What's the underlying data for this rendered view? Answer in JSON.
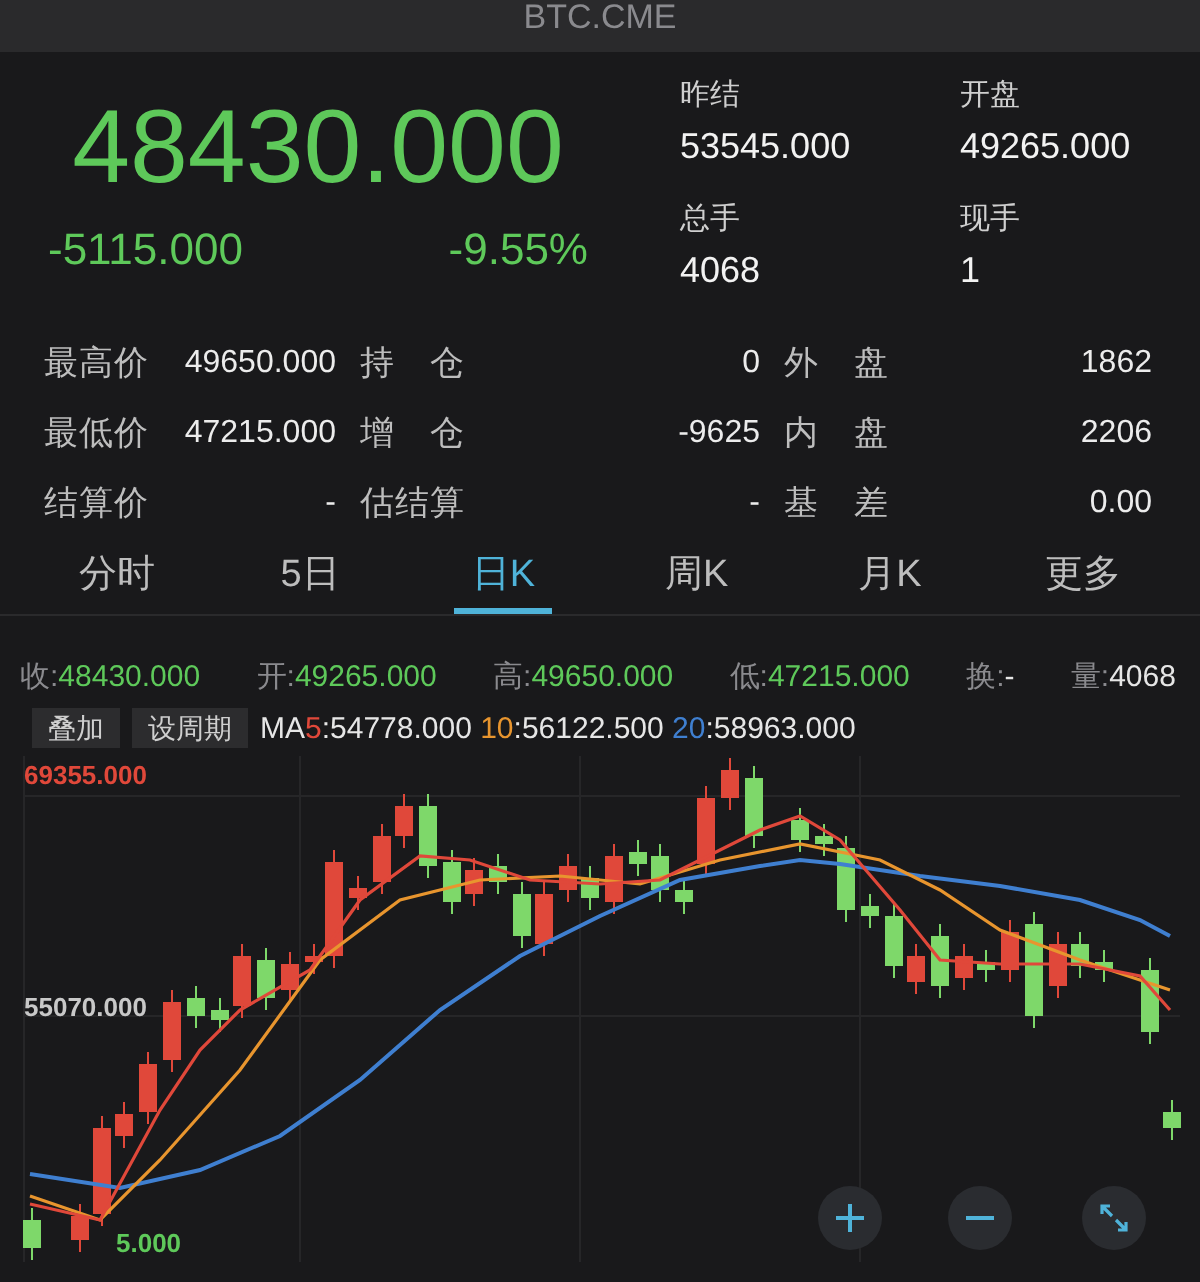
{
  "header": {
    "title": "BTC.CME"
  },
  "quote": {
    "price": "48430.000",
    "change": "-5115.000",
    "change_pct": "-9.55%",
    "fields": [
      {
        "label": "昨结",
        "value": "53545.000"
      },
      {
        "label": "开盘",
        "value": "49265.000"
      },
      {
        "label": "总手",
        "value": "4068"
      },
      {
        "label": "现手",
        "value": "1"
      }
    ]
  },
  "stats": [
    [
      {
        "label": "最高价",
        "value": "49650.000"
      },
      {
        "label": "持仓",
        "value": "0"
      },
      {
        "label": "外盘",
        "value": "1862"
      }
    ],
    [
      {
        "label": "最低价",
        "value": "47215.000"
      },
      {
        "label": "增仓",
        "value": "-9625"
      },
      {
        "label": "内盘",
        "value": "2206"
      }
    ],
    [
      {
        "label": "结算价",
        "value": "-"
      },
      {
        "label": "估结算",
        "value": "-"
      },
      {
        "label": "基差",
        "value": "0.00"
      }
    ]
  ],
  "tabs": [
    {
      "label": "分时",
      "selected": false
    },
    {
      "label": "5日",
      "selected": false
    },
    {
      "label": "日K",
      "selected": true
    },
    {
      "label": "周K",
      "selected": false
    },
    {
      "label": "月K",
      "selected": false
    },
    {
      "label": "更多",
      "selected": false
    }
  ],
  "ohlc": [
    {
      "label": "收:",
      "value": "48430.000",
      "color": "#5ec95a"
    },
    {
      "label": "开:",
      "value": "49265.000",
      "color": "#5ec95a"
    },
    {
      "label": "高:",
      "value": "49650.000",
      "color": "#5ec95a"
    },
    {
      "label": "低:",
      "value": "47215.000",
      "color": "#5ec95a"
    },
    {
      "label": "换:",
      "value": "-",
      "color": "#e6e6e6"
    },
    {
      "label": "量:",
      "value": "4068",
      "color": "#e6e6e6"
    }
  ],
  "chart_toolbar": {
    "buttons": [
      "叠加",
      "设周期"
    ],
    "ma_label": "MA",
    "ma": [
      {
        "period": "5",
        "value": ":54778.000",
        "color": "#e0483a"
      },
      {
        "period": "10",
        "value": ":56122.500",
        "color": "#e8952e"
      },
      {
        "period": "20",
        "value": ":58963.000",
        "color": "#3f7fd0"
      }
    ]
  },
  "chart": {
    "axis_labels": [
      {
        "text": "69355.000",
        "color": "#e0483a"
      },
      {
        "text": "55070.000",
        "color": "#c8c8c8"
      },
      {
        "text": "5.000",
        "color": "#5ec95a"
      }
    ]
  }
}
